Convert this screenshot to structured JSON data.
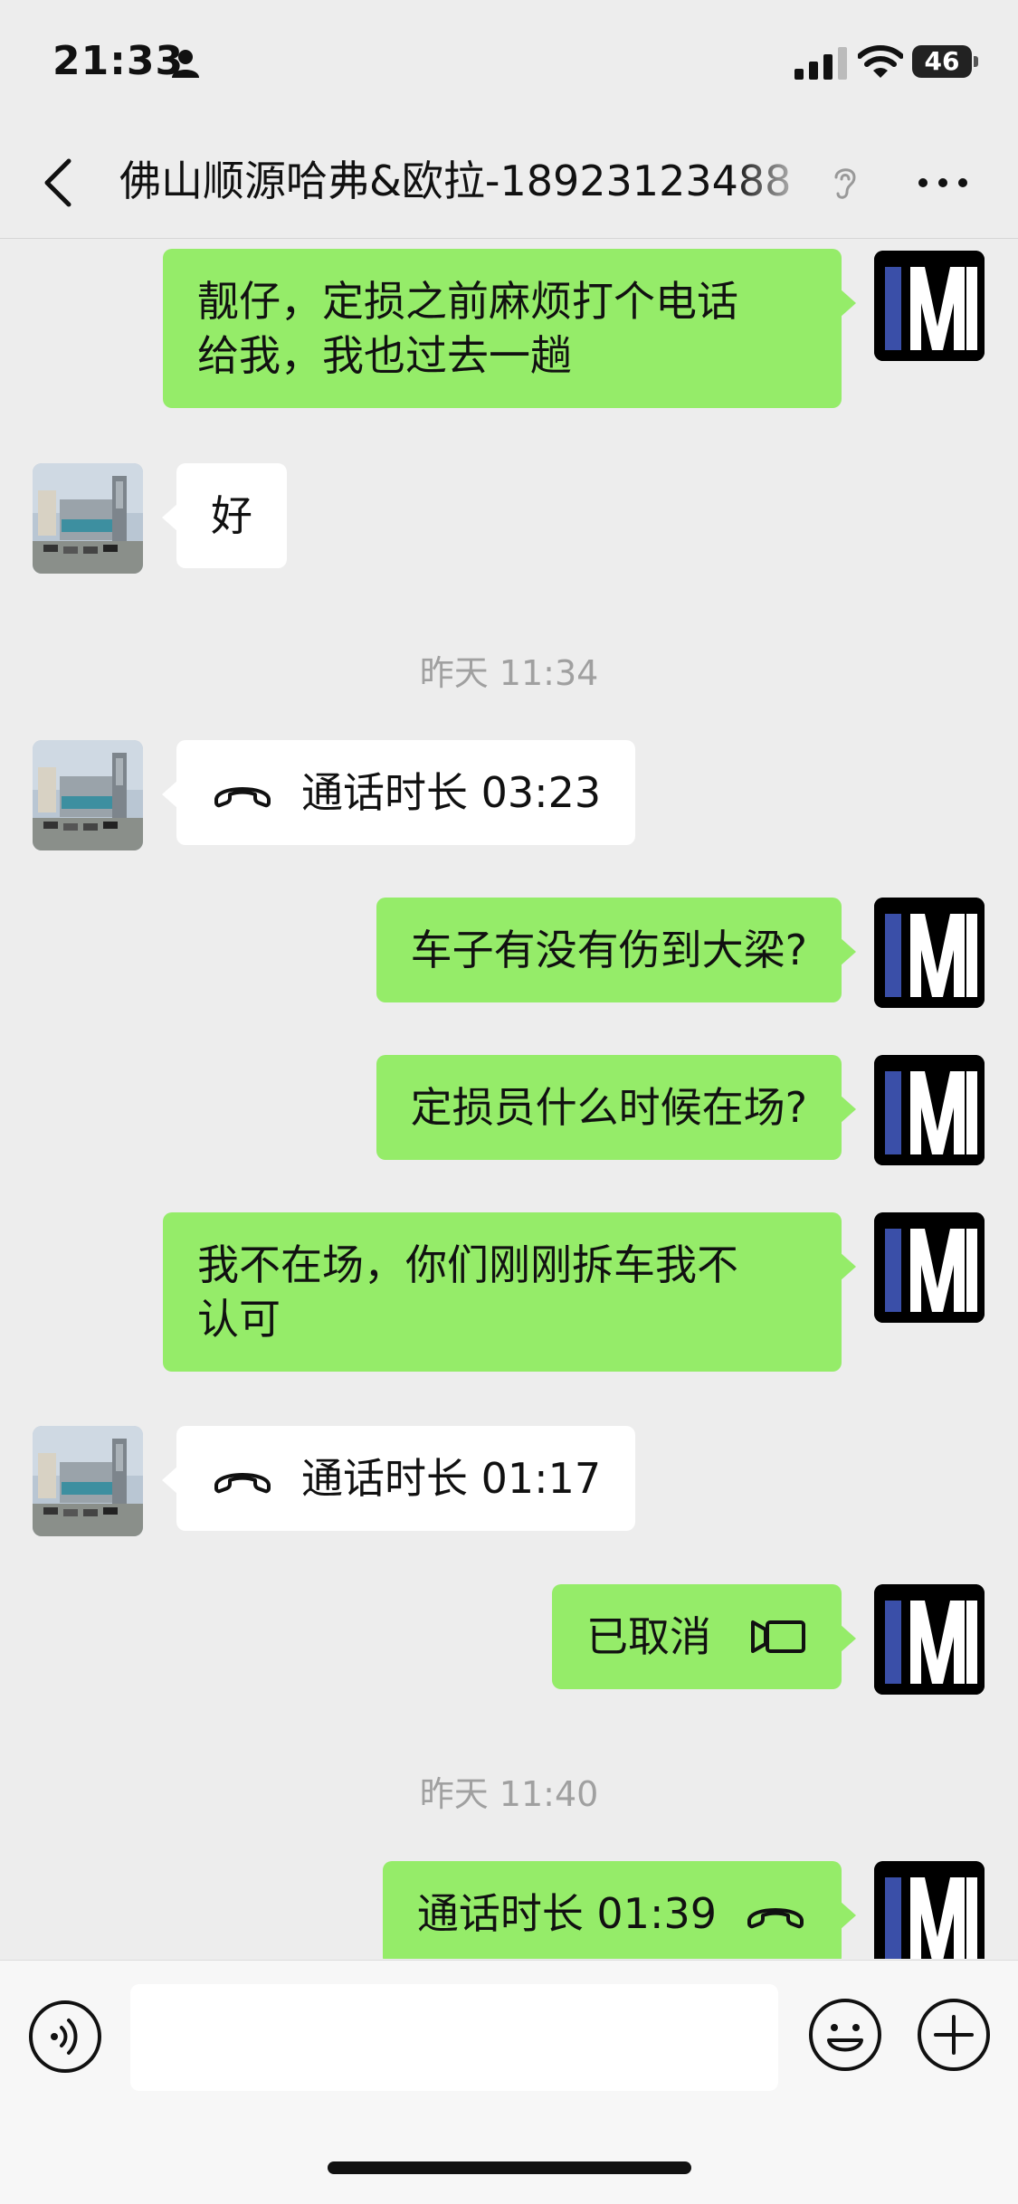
{
  "status_bar": {
    "time": "21:33",
    "battery": "46"
  },
  "nav": {
    "title": "佛山顺源哈弗&欧拉-18923123488"
  },
  "messages": [
    {
      "side": "out",
      "text_line1": "靓仔，定损之前麻烦打个电话",
      "text_line2": "给我，我也过去一趟"
    },
    {
      "side": "in",
      "text": "好"
    },
    {
      "type": "timestamp",
      "text": "昨天 11:34"
    },
    {
      "side": "in",
      "type": "call",
      "text": "通话时长 03:23"
    },
    {
      "side": "out",
      "text": "车子有没有伤到大梁?"
    },
    {
      "side": "out",
      "text": "定损员什么时候在场?"
    },
    {
      "side": "out",
      "text_line1": "我不在场，你们刚刚拆车我不",
      "text_line2": "认可"
    },
    {
      "side": "in",
      "type": "call",
      "text": "通话时长 01:17"
    },
    {
      "side": "out",
      "type": "video-call",
      "text": "已取消"
    },
    {
      "type": "timestamp",
      "text": "昨天 11:40"
    },
    {
      "side": "out",
      "type": "call",
      "text": "通话时长 01:39"
    }
  ],
  "colors": {
    "outgoing_bubble": "#95ec69",
    "incoming_bubble": "#ffffff",
    "background": "#ededed"
  },
  "icons": {
    "back": "chevron-left-icon",
    "ear": "ear-icon",
    "more": "more-icon",
    "voice": "voice-icon",
    "emoji": "emoji-icon",
    "plus": "plus-icon",
    "call": "phone-icon",
    "video": "video-camera-icon"
  }
}
